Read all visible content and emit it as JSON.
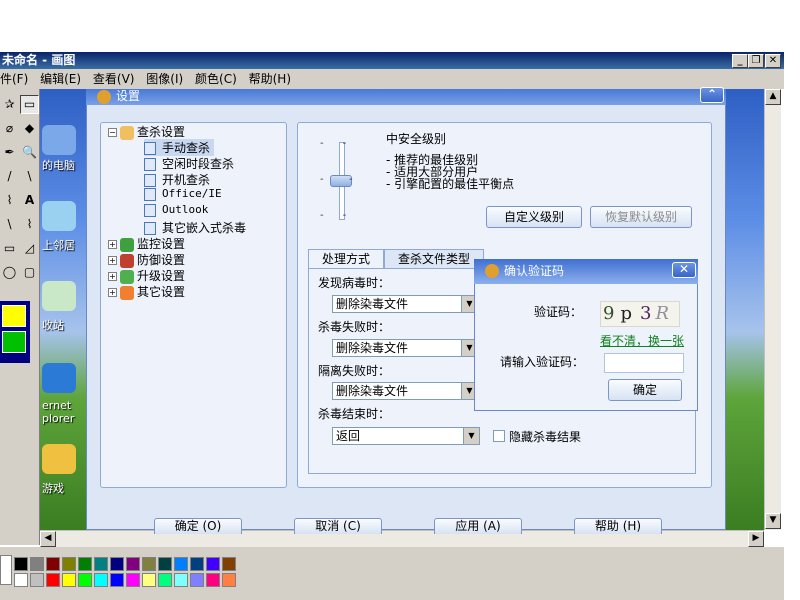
{
  "window": {
    "title": "未命名 - 画图",
    "min_label": "_",
    "max_label": "❐",
    "close_label": "✕"
  },
  "menu": [
    "件(F)",
    "编辑(E)",
    "查看(V)",
    "图像(I)",
    "颜色(C)",
    "帮助(H)"
  ],
  "desktop_labels": [
    "的电脑",
    "上邻居",
    "收站",
    "ernet",
    "plorer",
    "游戏"
  ],
  "tools": [
    "✰",
    "▭",
    "⌀",
    "◆",
    "✒",
    "🔍",
    "/",
    "A",
    "\\",
    "⌇",
    "▭",
    "◿",
    "◯",
    "▢"
  ],
  "palette_row1": [
    "#000000",
    "#808080",
    "#800000",
    "#808000",
    "#008000",
    "#008080",
    "#000080",
    "#800080",
    "#808040",
    "#004040",
    "#0080ff",
    "#004080",
    "#4000ff",
    "#804000"
  ],
  "palette_row2": [
    "#ffffff",
    "#c0c0c0",
    "#ff0000",
    "#ffff00",
    "#00ff00",
    "#00ffff",
    "#0000ff",
    "#ff00ff",
    "#ffff80",
    "#00ff80",
    "#80ffff",
    "#8080ff",
    "#ff0080",
    "#ff8040"
  ],
  "settings": {
    "title": "设置",
    "tree": {
      "scan": "查杀设置",
      "scan_children": [
        "手动查杀",
        "空闲时段查杀",
        "开机查杀",
        "Office/IE",
        "Outlook",
        "其它嵌入式杀毒"
      ],
      "others": [
        "监控设置",
        "防御设置",
        "升级设置",
        "其它设置"
      ]
    },
    "level": {
      "name": "中安全级别",
      "bullets": [
        "- 推荐的最佳级别",
        "- 适用大部分用户",
        "- 引擎配置的最佳平衡点"
      ],
      "custom_button": "自定义级别",
      "default_button": "恢复默认级别"
    },
    "tabs": [
      "处理方式",
      "查杀文件类型"
    ],
    "rows": [
      {
        "label": "发现病毒时：",
        "value": "删除染毒文件"
      },
      {
        "label": "杀毒失败时：",
        "value": "删除染毒文件"
      },
      {
        "label": "隔离失败时：",
        "value": "删除染毒文件"
      },
      {
        "label": "杀毒结束时：",
        "value": "返回"
      }
    ],
    "hide_result": "隐藏杀毒结果",
    "footer": [
      "确定 (O)",
      "取消 (C)",
      "应用 (A)",
      "帮助 (H)"
    ]
  },
  "captcha": {
    "title": "确认验证码",
    "code_label": "验证码：",
    "code_chars": [
      "9",
      "p",
      "3",
      "R"
    ],
    "refresh_link": "看不清，换一张",
    "input_label": "请输入验证码：",
    "input_value": "",
    "ok": "确定"
  }
}
